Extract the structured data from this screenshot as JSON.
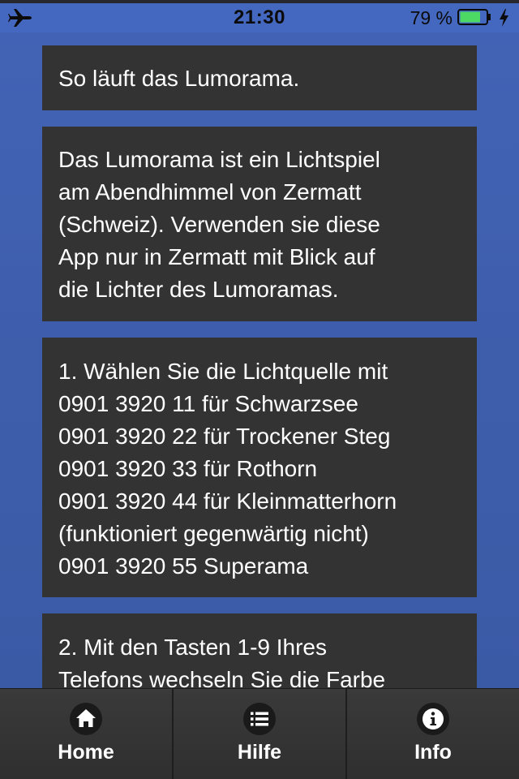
{
  "status": {
    "time": "21:30",
    "battery": "79 %",
    "battery_level": 0.79,
    "icons": [
      "airplane-mode-icon",
      "battery-icon",
      "charging-bolt-icon"
    ]
  },
  "cards": [
    {
      "lines": [
        "So läuft das Lumorama."
      ]
    },
    {
      "lines": [
        "Das Lumorama ist ein Lichtspiel",
        "am Abendhimmel von Zermatt",
        "(Schweiz). Verwenden sie diese",
        "App nur in Zermatt mit Blick auf",
        "die Lichter des Lumoramas."
      ]
    },
    {
      "lines": [
        "1. Wählen Sie die Lichtquelle mit",
        "0901 3920 11 für Schwarzsee",
        "0901 3920 22 für Trockener Steg",
        "0901 3920 33 für Rothorn",
        "0901 3920 44 für Kleinmatterhorn",
        "(funktioniert gegenwärtig nicht)",
        "0901 3920 55 Superama"
      ]
    },
    {
      "lines": [
        "2. Mit den Tasten 1-9 Ihres",
        "Telefons wechseln Sie die Farbe"
      ]
    }
  ],
  "tabbar": {
    "tabs": [
      {
        "label": "Home",
        "icon": "home-icon"
      },
      {
        "label": "Hilfe",
        "icon": "list-icon"
      },
      {
        "label": "Info",
        "icon": "info-icon"
      }
    ]
  },
  "colors": {
    "background": "#3f5fae",
    "card": "#333333",
    "tabbar": "#2e2e2e",
    "battery_fill": "#4cd964"
  }
}
